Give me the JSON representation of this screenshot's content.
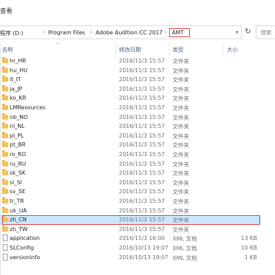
{
  "menubar": {
    "view_label": "查看"
  },
  "address": {
    "drive_label": "程序 (D:)",
    "crumbs": [
      "Program Files",
      "Adobe Audition CC 2017",
      "AMT"
    ],
    "search_placeholder": "搜索"
  },
  "columns": {
    "name": "名称",
    "date": "修改日期",
    "type": "类型",
    "size": "大小"
  },
  "selected_color": "#cce8ff",
  "highlight_color": "#e23a3a",
  "rows": [
    {
      "name": "hr_HR",
      "date": "2016/11/3 15:57",
      "type": "文件夹",
      "size": "",
      "icon": "folder-icon"
    },
    {
      "name": "hu_HU",
      "date": "2016/11/3 15:57",
      "type": "文件夹",
      "size": "",
      "icon": "folder-icon"
    },
    {
      "name": "it_IT",
      "date": "2016/11/3 15:57",
      "type": "文件夹",
      "size": "",
      "icon": "folder-icon"
    },
    {
      "name": "ja_JP",
      "date": "2016/11/3 15:57",
      "type": "文件夹",
      "size": "",
      "icon": "folder-icon"
    },
    {
      "name": "ko_KR",
      "date": "2016/11/3 15:57",
      "type": "文件夹",
      "size": "",
      "icon": "folder-icon"
    },
    {
      "name": "LMResources",
      "date": "2016/11/3 15:57",
      "type": "文件夹",
      "size": "",
      "icon": "folder-icon"
    },
    {
      "name": "nb_NO",
      "date": "2016/11/3 15:57",
      "type": "文件夹",
      "size": "",
      "icon": "folder-icon"
    },
    {
      "name": "nl_NL",
      "date": "2016/11/3 15:57",
      "type": "文件夹",
      "size": "",
      "icon": "folder-icon"
    },
    {
      "name": "pl_PL",
      "date": "2016/11/3 15:57",
      "type": "文件夹",
      "size": "",
      "icon": "folder-icon"
    },
    {
      "name": "pt_BR",
      "date": "2016/11/3 15:57",
      "type": "文件夹",
      "size": "",
      "icon": "folder-icon"
    },
    {
      "name": "ro_RO",
      "date": "2016/11/3 15:57",
      "type": "文件夹",
      "size": "",
      "icon": "folder-icon"
    },
    {
      "name": "ru_RU",
      "date": "2016/11/3 15:57",
      "type": "文件夹",
      "size": "",
      "icon": "folder-icon"
    },
    {
      "name": "sk_SK",
      "date": "2016/11/3 15:57",
      "type": "文件夹",
      "size": "",
      "icon": "folder-icon"
    },
    {
      "name": "sl_SI",
      "date": "2016/11/3 15:57",
      "type": "文件夹",
      "size": "",
      "icon": "folder-icon"
    },
    {
      "name": "sv_SE",
      "date": "2016/11/3 15:57",
      "type": "文件夹",
      "size": "",
      "icon": "folder-icon"
    },
    {
      "name": "tr_TR",
      "date": "2016/11/3 15:57",
      "type": "文件夹",
      "size": "",
      "icon": "folder-icon"
    },
    {
      "name": "uk_UA",
      "date": "2016/11/3 15:57",
      "type": "文件夹",
      "size": "",
      "icon": "folder-icon"
    },
    {
      "name": "zh_CN",
      "date": "2016/11/3 15:57",
      "type": "文件夹",
      "size": "",
      "icon": "folder-icon",
      "selected": true
    },
    {
      "name": "zh_TW",
      "date": "2016/11/3 15:57",
      "type": "文件夹",
      "size": "",
      "icon": "folder-icon"
    },
    {
      "name": "application",
      "date": "2016/11/3 16:00",
      "type": "XML 文档",
      "size": "13 KB",
      "icon": "file-icon"
    },
    {
      "name": "SLConfig",
      "date": "2016/10/13 19:07",
      "type": "XML 文档",
      "size": "10 KB",
      "icon": "file-icon"
    },
    {
      "name": "versioninfo",
      "date": "2016/10/13 19:07",
      "type": "XML 文档",
      "size": "1 KB",
      "icon": "file-icon"
    }
  ]
}
